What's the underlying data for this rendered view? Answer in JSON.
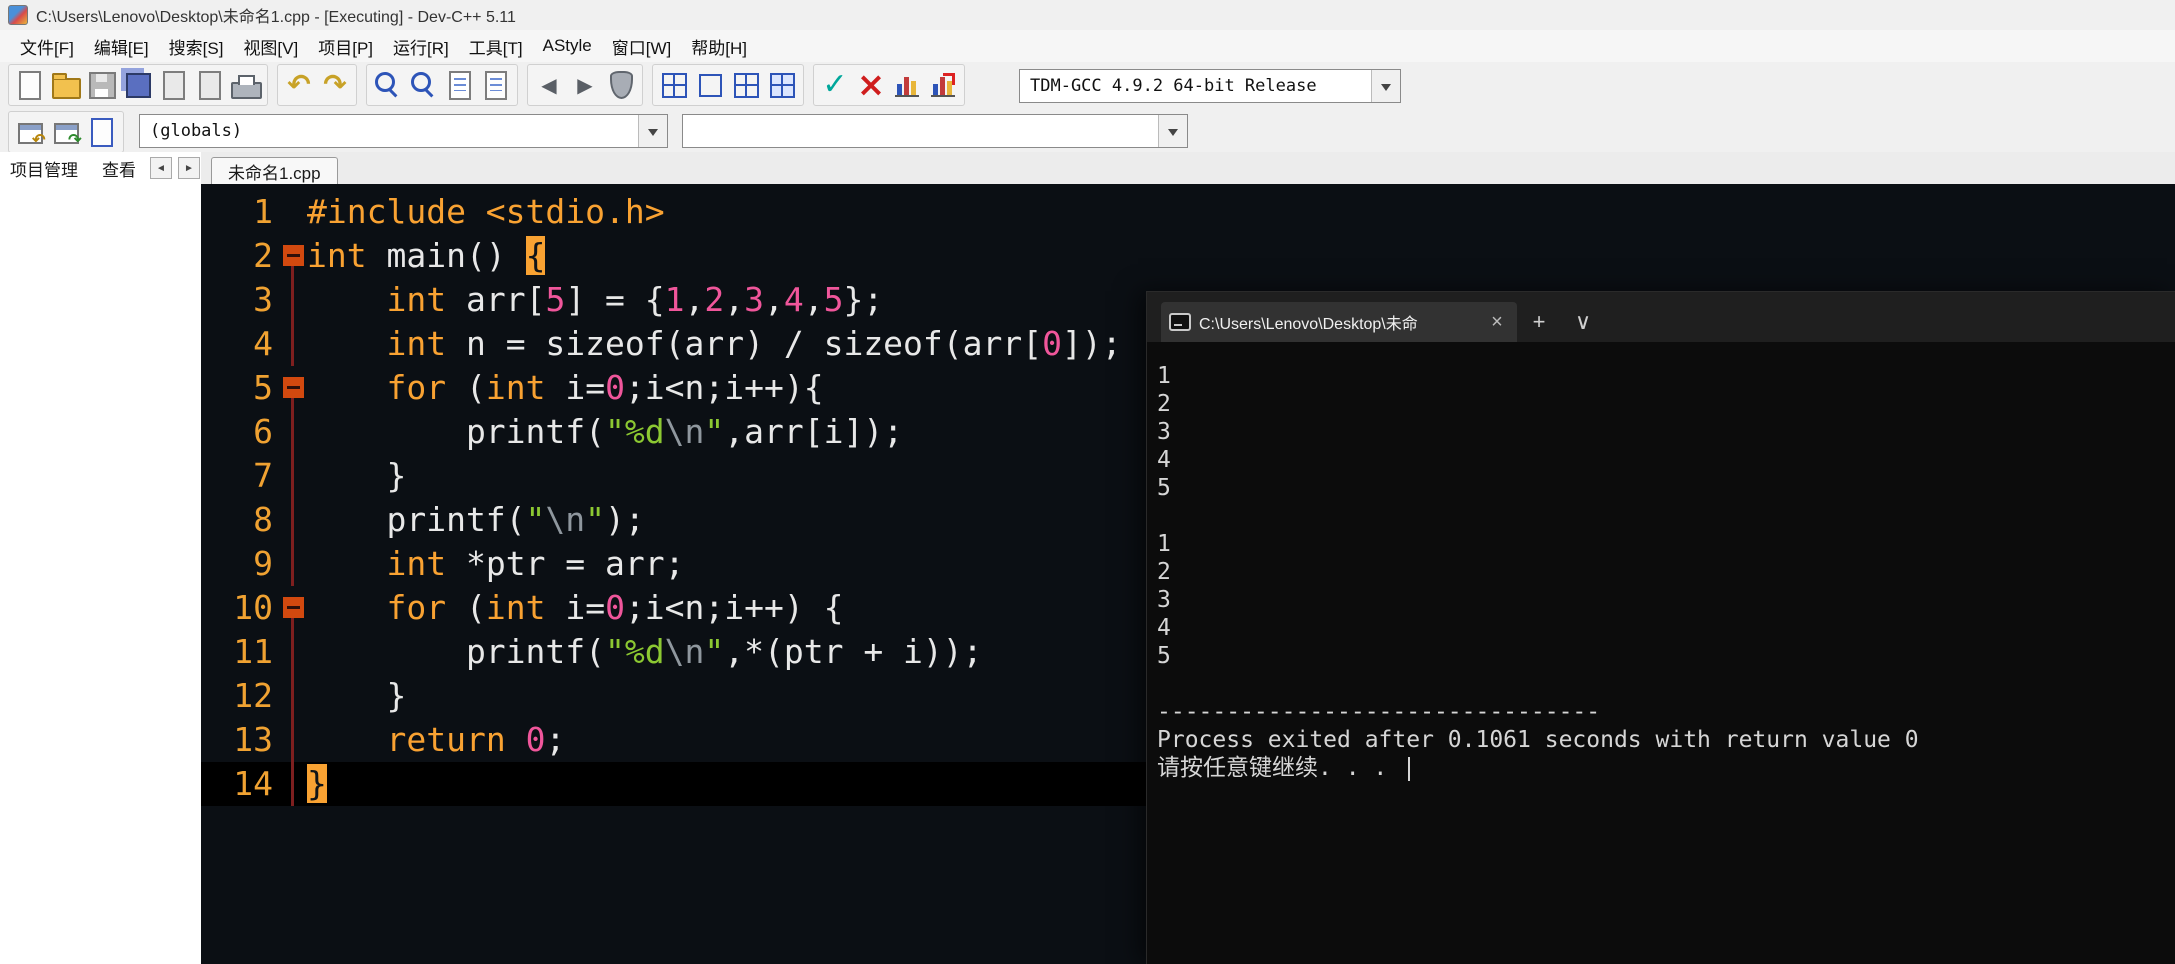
{
  "titlebar": {
    "title": "C:\\Users\\Lenovo\\Desktop\\未命名1.cpp - [Executing] - Dev-C++ 5.11"
  },
  "menubar": {
    "items": [
      "文件[F]",
      "编辑[E]",
      "搜索[S]",
      "视图[V]",
      "项目[P]",
      "运行[R]",
      "工具[T]",
      "AStyle",
      "窗口[W]",
      "帮助[H]"
    ]
  },
  "toolbars": {
    "row1_groups": [
      [
        {
          "name": "new-file",
          "cls": "sh-page"
        },
        {
          "name": "open-file",
          "cls": "sh-folder"
        },
        {
          "name": "save",
          "cls": "sh-floppy gray"
        },
        {
          "name": "save-all",
          "cls": "sh-floppies"
        },
        {
          "name": "close-file",
          "cls": "sh-page dim"
        },
        {
          "name": "close-all",
          "cls": "sh-page dim"
        },
        {
          "name": "print",
          "cls": "sh-print"
        }
      ],
      [
        {
          "name": "undo",
          "glyph": "↶",
          "gcls": "g-undo"
        },
        {
          "name": "redo",
          "glyph": "↷",
          "gcls": "g-undo"
        }
      ],
      [
        {
          "name": "find",
          "cls": "sh-mag"
        },
        {
          "name": "find-next",
          "cls": "sh-mag"
        },
        {
          "name": "replace",
          "cls": "sh-doclines"
        },
        {
          "name": "goto-line",
          "cls": "sh-page lines"
        }
      ],
      [
        {
          "name": "back",
          "glyph": "◀",
          "gcls": "g-nav"
        },
        {
          "name": "forward",
          "glyph": "▶",
          "gcls": "g-nav"
        },
        {
          "name": "abort-debug",
          "cls": "sh-shield"
        }
      ],
      [
        {
          "name": "compile",
          "cls": "sh-grid"
        },
        {
          "name": "run",
          "cls": "sh-sq"
        },
        {
          "name": "compile-run",
          "cls": "sh-grid"
        },
        {
          "name": "rebuild",
          "cls": "sh-grid2"
        }
      ],
      [
        {
          "name": "syntax-check",
          "glyph": "✓",
          "gcls": "g-check"
        },
        {
          "name": "abort-compile",
          "glyph": "×",
          "gcls": "g-abort"
        },
        {
          "name": "profile",
          "cls": "sh-chart"
        },
        {
          "name": "profile-delete",
          "cls": "sh-chart del"
        }
      ]
    ],
    "row2_buttons": [
      {
        "name": "goto-declaration",
        "cls": "sh-win back"
      },
      {
        "name": "goto-definition",
        "cls": "sh-win fwd"
      },
      {
        "name": "insert-unit",
        "cls": "sh-page blue"
      }
    ],
    "compiler_combo": {
      "value": "TDM-GCC 4.9.2 64-bit Release"
    },
    "globals_combo": {
      "value": "(globals)"
    },
    "members_combo": {
      "value": ""
    }
  },
  "panel": {
    "tabs": [
      "项目管理",
      "查看"
    ],
    "prev_icon": "◄",
    "next_icon": "►"
  },
  "editor": {
    "tab": "未命名1.cpp",
    "colors": {
      "background": "#0b0f14",
      "keyword": "#f9a232",
      "number": "#f0569b",
      "string": "#8cc832",
      "line_number": "#f0a232",
      "current_line": "#000000",
      "brace_highlight": "#f9a232",
      "fold_line": "#7e1f1f"
    },
    "lines": [
      {
        "n": 1,
        "fold": "",
        "cur": false,
        "tokens": [
          {
            "t": "#include <stdio.h>",
            "c": "pp"
          }
        ]
      },
      {
        "n": 2,
        "fold": "box",
        "cur": false,
        "tokens": [
          {
            "t": "int",
            "c": "kw"
          },
          {
            "t": " main() ",
            "c": "pl"
          },
          {
            "t": "{",
            "c": "hb"
          }
        ]
      },
      {
        "n": 3,
        "fold": "line",
        "cur": false,
        "tokens": [
          {
            "t": "    ",
            "c": "pl"
          },
          {
            "t": "int",
            "c": "kw"
          },
          {
            "t": " arr[",
            "c": "pl"
          },
          {
            "t": "5",
            "c": "num"
          },
          {
            "t": "] = {",
            "c": "pl"
          },
          {
            "t": "1",
            "c": "num"
          },
          {
            "t": ",",
            "c": "pl"
          },
          {
            "t": "2",
            "c": "num"
          },
          {
            "t": ",",
            "c": "pl"
          },
          {
            "t": "3",
            "c": "num"
          },
          {
            "t": ",",
            "c": "pl"
          },
          {
            "t": "4",
            "c": "num"
          },
          {
            "t": ",",
            "c": "pl"
          },
          {
            "t": "5",
            "c": "num"
          },
          {
            "t": "};",
            "c": "pl"
          }
        ]
      },
      {
        "n": 4,
        "fold": "line",
        "cur": false,
        "tokens": [
          {
            "t": "    ",
            "c": "pl"
          },
          {
            "t": "int",
            "c": "kw"
          },
          {
            "t": " n = sizeof(arr) / sizeof(arr[",
            "c": "pl"
          },
          {
            "t": "0",
            "c": "num"
          },
          {
            "t": "]);",
            "c": "pl"
          }
        ]
      },
      {
        "n": 5,
        "fold": "box",
        "cur": false,
        "tokens": [
          {
            "t": "    ",
            "c": "pl"
          },
          {
            "t": "for",
            "c": "kw"
          },
          {
            "t": " (",
            "c": "pl"
          },
          {
            "t": "int",
            "c": "kw"
          },
          {
            "t": " i=",
            "c": "pl"
          },
          {
            "t": "0",
            "c": "num"
          },
          {
            "t": ";i<n;i++){",
            "c": "pl"
          }
        ]
      },
      {
        "n": 6,
        "fold": "line",
        "cur": false,
        "tokens": [
          {
            "t": "        printf(",
            "c": "pl"
          },
          {
            "t": "\"%d",
            "c": "str"
          },
          {
            "t": "\\n",
            "c": "esc"
          },
          {
            "t": "\"",
            "c": "str"
          },
          {
            "t": ",arr[i]);",
            "c": "pl"
          }
        ]
      },
      {
        "n": 7,
        "fold": "line",
        "cur": false,
        "tokens": [
          {
            "t": "    }",
            "c": "pl"
          }
        ]
      },
      {
        "n": 8,
        "fold": "line",
        "cur": false,
        "tokens": [
          {
            "t": "    printf(",
            "c": "pl"
          },
          {
            "t": "\"",
            "c": "str"
          },
          {
            "t": "\\n",
            "c": "esc"
          },
          {
            "t": "\"",
            "c": "str"
          },
          {
            "t": ");",
            "c": "pl"
          }
        ]
      },
      {
        "n": 9,
        "fold": "line",
        "cur": false,
        "tokens": [
          {
            "t": "    ",
            "c": "pl"
          },
          {
            "t": "int",
            "c": "kw"
          },
          {
            "t": " *ptr = arr;",
            "c": "pl"
          }
        ]
      },
      {
        "n": 10,
        "fold": "box",
        "cur": false,
        "tokens": [
          {
            "t": "    ",
            "c": "pl"
          },
          {
            "t": "for",
            "c": "kw"
          },
          {
            "t": " (",
            "c": "pl"
          },
          {
            "t": "int",
            "c": "kw"
          },
          {
            "t": " i=",
            "c": "pl"
          },
          {
            "t": "0",
            "c": "num"
          },
          {
            "t": ";i<n;i++) {",
            "c": "pl"
          }
        ]
      },
      {
        "n": 11,
        "fold": "line",
        "cur": false,
        "tokens": [
          {
            "t": "        printf(",
            "c": "pl"
          },
          {
            "t": "\"%d",
            "c": "str"
          },
          {
            "t": "\\n",
            "c": "esc"
          },
          {
            "t": "\"",
            "c": "str"
          },
          {
            "t": ",*(ptr + i));",
            "c": "pl"
          }
        ]
      },
      {
        "n": 12,
        "fold": "line",
        "cur": false,
        "tokens": [
          {
            "t": "    }",
            "c": "pl"
          }
        ]
      },
      {
        "n": 13,
        "fold": "line",
        "cur": false,
        "tokens": [
          {
            "t": "    ",
            "c": "pl"
          },
          {
            "t": "return",
            "c": "kw"
          },
          {
            "t": " ",
            "c": "pl"
          },
          {
            "t": "0",
            "c": "num"
          },
          {
            "t": ";",
            "c": "pl"
          }
        ]
      },
      {
        "n": 14,
        "fold": "line",
        "cur": true,
        "tokens": [
          {
            "t": "}",
            "c": "hb"
          }
        ]
      }
    ]
  },
  "console": {
    "tab": {
      "title": "C:\\Users\\Lenovo\\Desktop\\未命",
      "close_icon": "×"
    },
    "new_tab_icon": "+",
    "dropdown_icon": "∨",
    "colors": {
      "background": "#0c0c0c",
      "tab_bar": "#1f1f1f",
      "text": "#d6d6d6"
    },
    "lines": [
      "1",
      "2",
      "3",
      "4",
      "5",
      "",
      "1",
      "2",
      "3",
      "4",
      "5",
      "",
      "--------------------------------",
      "Process exited after 0.1061 seconds with return value 0",
      "请按任意键继续. . . "
    ],
    "cursor_visible": true
  }
}
